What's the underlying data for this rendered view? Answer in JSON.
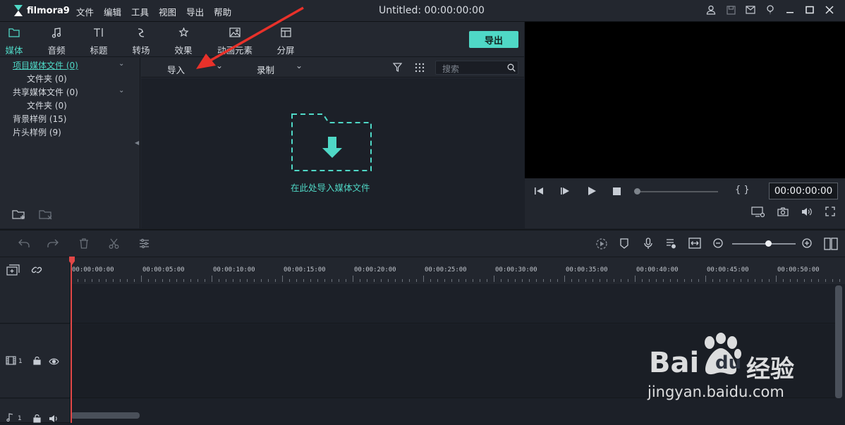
{
  "app": {
    "logo_text": "filmora9",
    "title": "Untitled:  00:00:00:00",
    "menu": [
      "文件",
      "编辑",
      "工具",
      "视图",
      "导出",
      "帮助"
    ]
  },
  "window_controls": [
    "user-icon",
    "save-icon",
    "mail-icon",
    "info-icon",
    "minimize-icon",
    "maximize-icon",
    "close-icon"
  ],
  "tabs": [
    {
      "label": "媒体",
      "icon": "folder-icon",
      "active": true
    },
    {
      "label": "音频",
      "icon": "music-note-icon"
    },
    {
      "label": "标题",
      "icon": "title-text-icon"
    },
    {
      "label": "转场",
      "icon": "transition-icon"
    },
    {
      "label": "效果",
      "icon": "effects-icon"
    },
    {
      "label": "动画元素",
      "icon": "elements-icon"
    },
    {
      "label": "分屏",
      "icon": "split-screen-icon"
    }
  ],
  "export_label": "导出",
  "sidebar": {
    "items": [
      {
        "label": "项目媒体文件 (0)",
        "selected": true
      },
      {
        "label": "文件夹 (0)"
      },
      {
        "label": "共享媒体文件 (0)"
      },
      {
        "label": "文件夹 (0)"
      },
      {
        "label": "背景样例 (15)"
      },
      {
        "label": "片头样例 (9)"
      }
    ]
  },
  "media_bar": {
    "import_label": "导入",
    "record_label": "录制",
    "search_placeholder": "搜索"
  },
  "media_area": {
    "drop_hint": "在此处导入媒体文件"
  },
  "preview": {
    "timecode": "00:00:00:00",
    "bracket_label": "{  }"
  },
  "timeline": {
    "ruler_labels": [
      "00:00:00:00",
      "00:00:05:00",
      "00:00:10:00",
      "00:00:15:00",
      "00:00:20:00",
      "00:00:25:00",
      "00:00:30:00",
      "00:00:35:00",
      "00:00:40:00",
      "00:00:45:00",
      "00:00:50:00"
    ],
    "video_track_label": "1",
    "audio_track_label": "1"
  },
  "watermark": {
    "brand_left": "Bai",
    "brand_right": "du",
    "brand_cn": "经验",
    "url": "jingyan.baidu.com"
  },
  "colors": {
    "accent": "#4fd8c6",
    "playhead": "#e24747",
    "annotation_arrow": "#e8312a"
  }
}
